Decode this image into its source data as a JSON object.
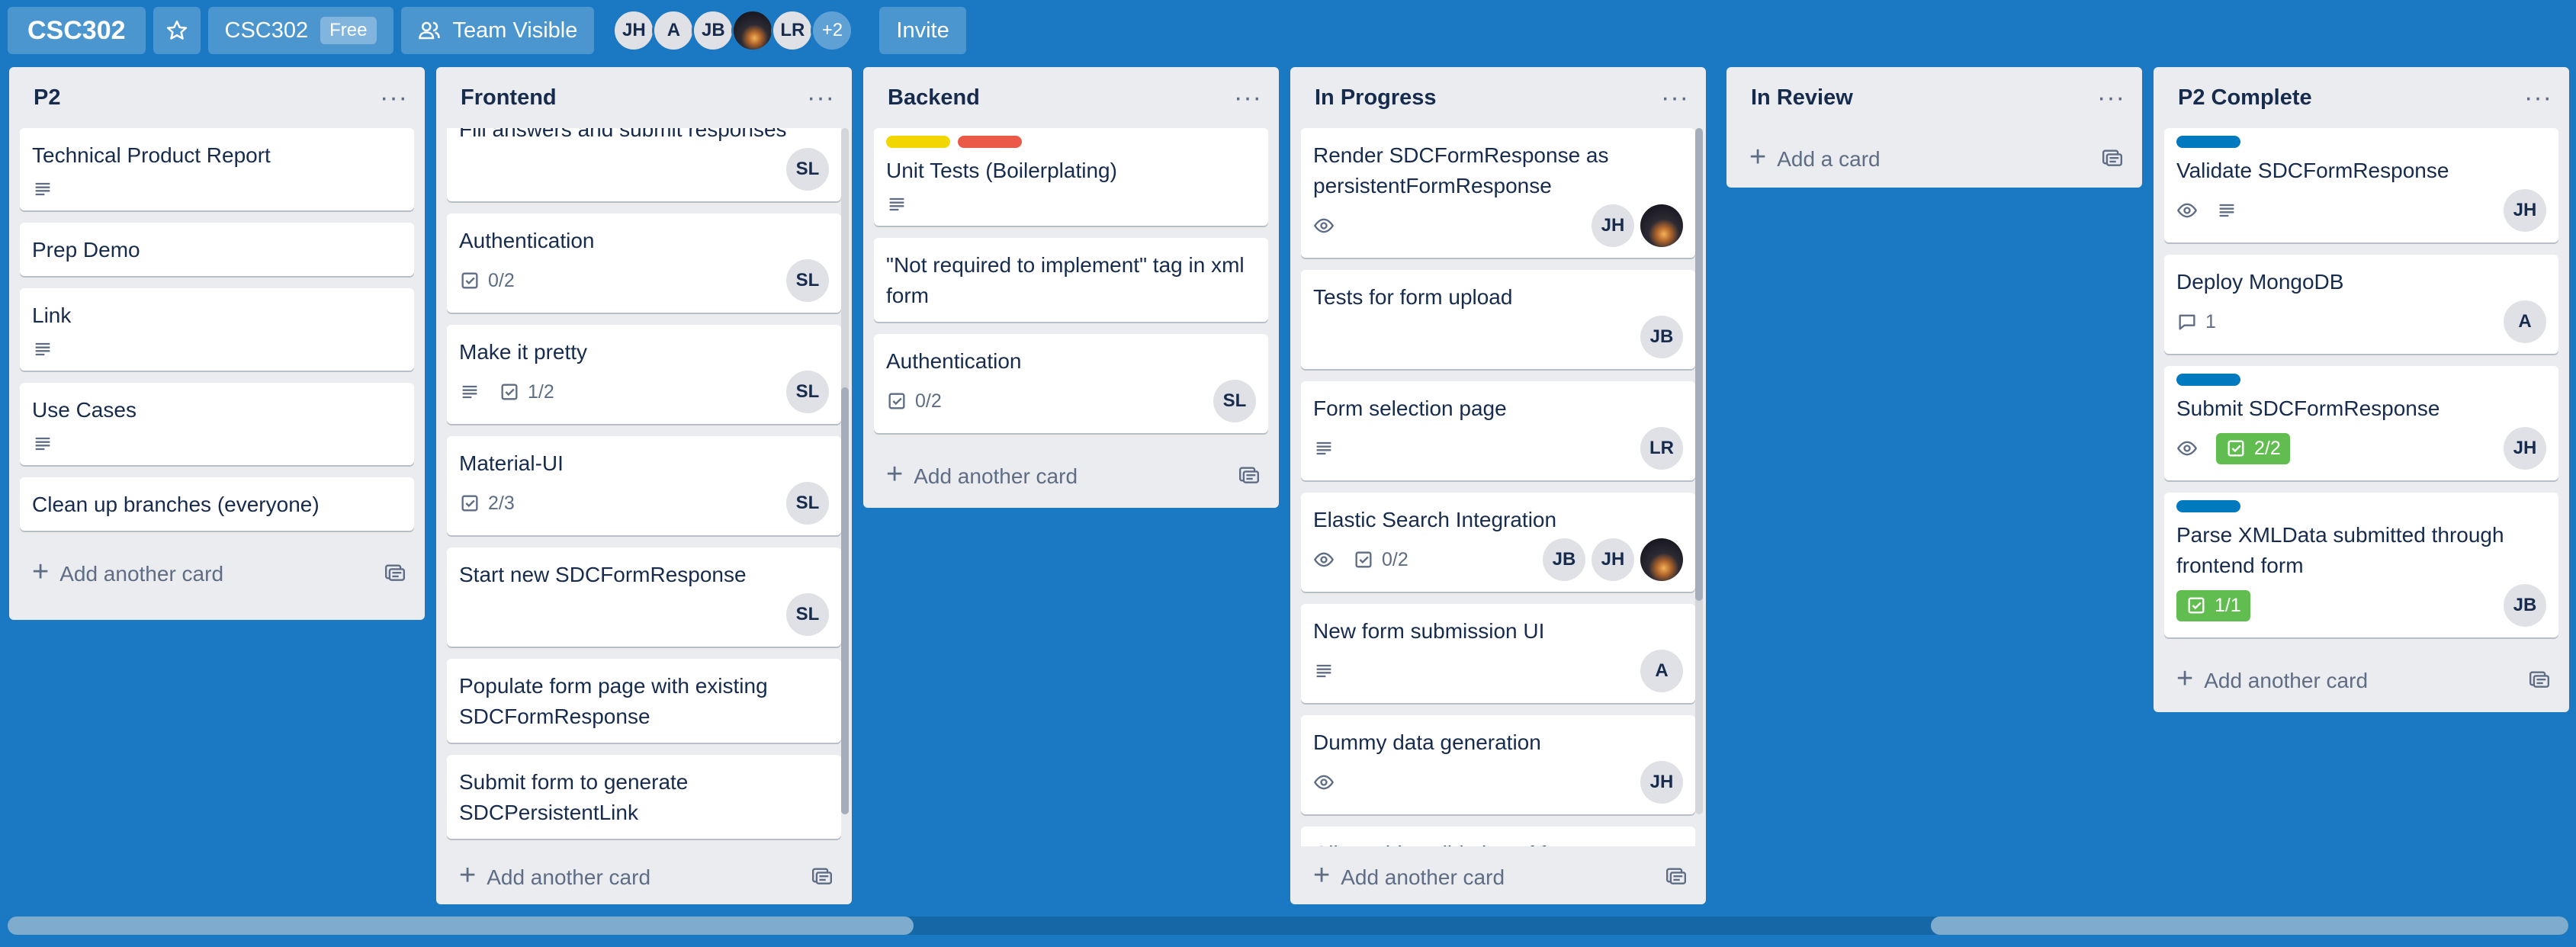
{
  "header": {
    "board_title": "CSC302",
    "workspace": "CSC302",
    "workspace_badge": "Free",
    "visibility": "Team Visible",
    "members": [
      "JH",
      "A",
      "JB",
      "",
      "LR"
    ],
    "members_more": "+2",
    "invite": "Invite",
    "star_icon": "star-outline-icon",
    "team_icon": "team-icon"
  },
  "colors": {
    "board_bg": "#1a79c2",
    "label_yellow": "#f2d600",
    "label_red": "#eb5a46",
    "label_blue": "#0079bf",
    "badge_green": "#61bd4f"
  },
  "lists": {
    "p2": {
      "title": "P2",
      "cards": [
        "Technical Product Report",
        "Prep Demo",
        "Link",
        "Use Cases",
        "Clean up branches (everyone)"
      ],
      "add": "Add another card"
    },
    "frontend": {
      "title": "Frontend",
      "cards": [
        "Fill answers and submit responses",
        "Authentication",
        "Make it pretty",
        "Material-UI",
        "Start new SDCFormResponse",
        "Populate form page with existing SDCFormResponse",
        "Submit form to generate SDCPersistentLink"
      ],
      "checklists": [
        "0/2",
        "1/2",
        "2/3"
      ],
      "member": "SL",
      "add": "Add another card"
    },
    "backend": {
      "title": "Backend",
      "cards": [
        "Unit Tests (Boilerplating)",
        "\"Not required to implement\" tag in xml form",
        "Authentication"
      ],
      "checklists": [
        "0/2"
      ],
      "member": "SL",
      "add": "Add another card"
    },
    "inprogress": {
      "title": "In Progress",
      "cards": [
        "Render SDCFormResponse as persistentFormResponse",
        "Tests for form upload",
        "Form selection page",
        "Elastic Search Integration",
        "New form submission UI",
        "Dummy data generation",
        "Client-side validation of form"
      ],
      "checklists": [
        "0/2"
      ],
      "members": [
        "JH",
        "JB",
        "LR",
        "A"
      ],
      "add": "Add another card"
    },
    "inreview": {
      "title": "In Review",
      "add": "Add a card"
    },
    "p2complete": {
      "title": "P2 Complete",
      "cards": [
        "Validate SDCFormResponse",
        "Deploy MongoDB",
        "Submit SDCFormResponse",
        "Parse XMLData submitted through frontend form"
      ],
      "comments": "1",
      "checklists": [
        "2/2",
        "1/1"
      ],
      "members": [
        "JH",
        "A",
        "JB"
      ],
      "add": "Add another card"
    }
  }
}
